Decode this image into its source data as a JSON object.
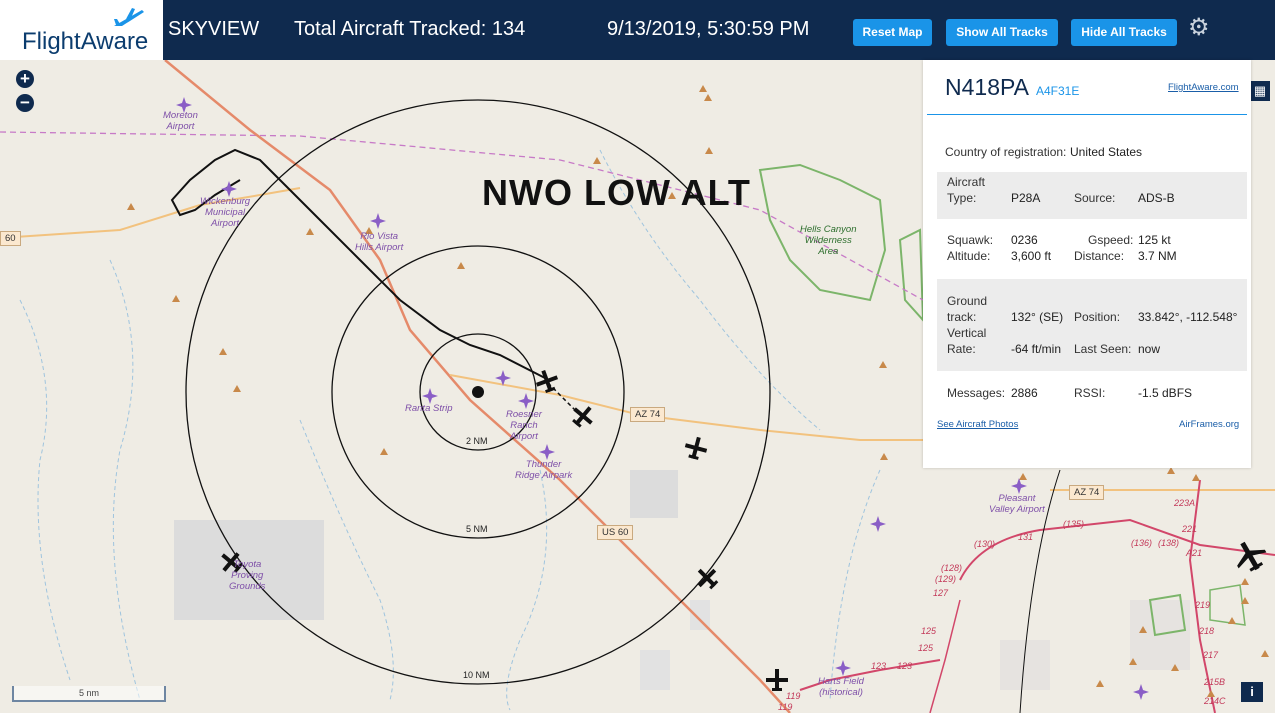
{
  "header": {
    "brand": "FlightAware",
    "app_name": "SKYVIEW",
    "aircraft_tracked": "Total Aircraft Tracked: 134",
    "datetime": "9/13/2019, 5:30:59 PM",
    "reset_label": "Reset Map",
    "show_tracks_label": "Show All Tracks",
    "hide_tracks_label": "Hide All Tracks",
    "settings_icon": "gear-icon"
  },
  "map": {
    "overlay_title": "NWO LOW ALT",
    "rings": [
      "2 NM",
      "5 NM",
      "10 NM"
    ],
    "scale_label": "5 nm",
    "airports": [
      {
        "name": "Moreton\nAirport"
      },
      {
        "name": "Wickenburg\nMunicipal\nAirport"
      },
      {
        "name": "Rio Vista\nHills Airport"
      },
      {
        "name": "Ranta Strip"
      },
      {
        "name": "Roesner\nRanch\nAirport"
      },
      {
        "name": "Thunder\nRidge Airpark"
      },
      {
        "name": "Pleasant\nValley Airport"
      },
      {
        "name": "Harts Field\n(historical)"
      },
      {
        "name": "Toyota\nProving\nGrounds"
      }
    ],
    "areas": [
      {
        "name": "Hells Canyon\nWilderness\nArea"
      }
    ],
    "road_shields": [
      "60",
      "AZ 74",
      "US 60",
      "AZ 74"
    ],
    "road_numbers": [
      "(135)",
      "(130)",
      "131",
      "(136)",
      "(138)",
      "A21",
      "223A",
      "221",
      "(128)",
      "(129)",
      "127",
      "125",
      "125",
      "123",
      "123",
      "219",
      "218",
      "217",
      "215B",
      "214C",
      "119",
      "119"
    ]
  },
  "panel": {
    "registration": "N418PA",
    "hex": "A4F31E",
    "link": "FlightAware.com",
    "country_label": "Country of registration:",
    "country": "United States",
    "aircraft_type_label": "Aircraft\nType:",
    "aircraft_type": "P28A",
    "source_label": "Source:",
    "source": "ADS-B",
    "squawk_label": "Squawk:",
    "squawk": "0236",
    "gspeed_label": "Gspeed:",
    "gspeed": "125 kt",
    "altitude_label": "Altitude:",
    "altitude": "3,600 ft",
    "distance_label": "Distance:",
    "distance": "3.7 NM",
    "ground_track_label": "Ground\ntrack:",
    "ground_track": "132° (SE)",
    "position_label": "Position:",
    "position": "33.842°, -112.548°",
    "vrate_label": "Vertical\nRate:",
    "vrate": "-64 ft/min",
    "last_seen_label": "Last Seen:",
    "last_seen": "now",
    "messages_label": "Messages:",
    "messages": "2886",
    "rssi_label": "RSSI:",
    "rssi": "-1.5 dBFS",
    "photos_link": "See Aircraft Photos",
    "airframes_link": "AirFrames.org"
  }
}
